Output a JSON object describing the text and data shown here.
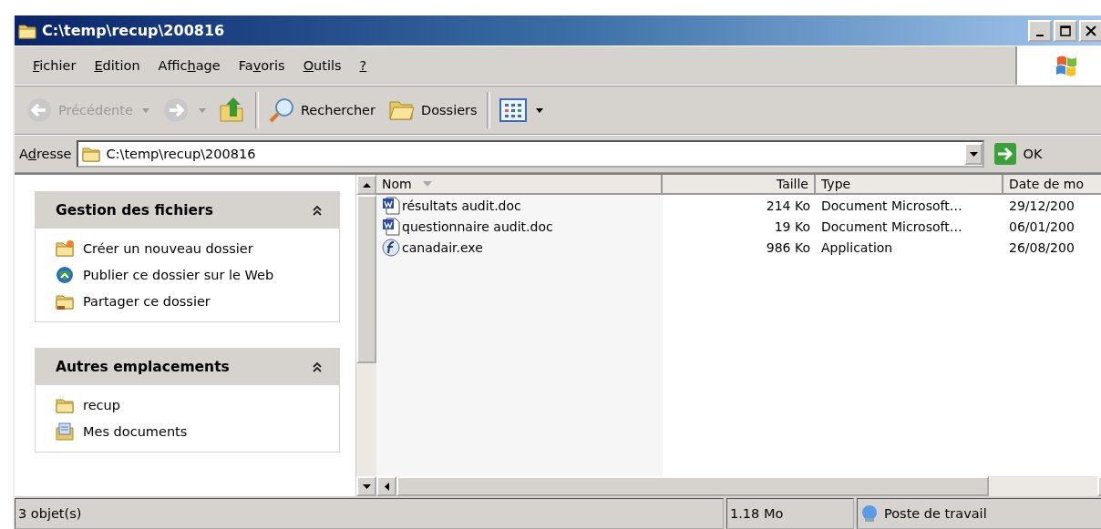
{
  "window": {
    "title": "C:\\temp\\recup\\200816"
  },
  "menu": [
    {
      "key": "F",
      "after": "ichier"
    },
    {
      "key": "E",
      "after": "dition"
    },
    {
      "before": "Affic",
      "key": "h",
      "after": "age"
    },
    {
      "before": "Fa",
      "key": "v",
      "after": "oris"
    },
    {
      "key": "O",
      "after": "utils"
    },
    {
      "key": "?"
    }
  ],
  "toolbar": [
    {
      "kind": "back",
      "label": "Précédente",
      "disabled": true,
      "dropdown": true
    },
    {
      "kind": "forward",
      "disabled": true,
      "dropdown": true
    },
    {
      "kind": "up",
      "disabled": false
    },
    {
      "kind": "sep"
    },
    {
      "kind": "search",
      "label": "Rechercher",
      "disabled": false
    },
    {
      "kind": "folders",
      "label": "Dossiers",
      "disabled": false
    },
    {
      "kind": "sep"
    },
    {
      "kind": "views",
      "disabled": false,
      "dropdown": true
    }
  ],
  "address": {
    "label": {
      "before": "A",
      "key": "d",
      "after": "resse"
    },
    "value": "C:\\temp\\recup\\200816",
    "go": "OK"
  },
  "panels": [
    {
      "title": "Gestion des fichiers",
      "expanded": true,
      "items": [
        {
          "kind": "newfolder",
          "label": "Créer un nouveau dossier"
        },
        {
          "kind": "web",
          "label": "Publier ce dossier sur le Web"
        },
        {
          "kind": "share",
          "label": "Partager ce dossier"
        }
      ]
    },
    {
      "title": "Autres emplacements",
      "expanded": true,
      "items": [
        {
          "kind": "folder",
          "label": "recup"
        },
        {
          "kind": "docs",
          "label": "Mes documents"
        }
      ]
    }
  ],
  "table": {
    "columns": [
      {
        "label": "Nom",
        "sorted": true
      },
      {
        "label": "Taille",
        "sorted": false
      },
      {
        "label": "Type",
        "sorted": false
      },
      {
        "label": "Date de mo",
        "sorted": false
      }
    ],
    "rows": [
      {
        "kind": "doc",
        "cells": [
          "résultats audit.doc",
          "214 Ko",
          "Document Microsoft…",
          "29/12/200"
        ]
      },
      {
        "kind": "doc",
        "cells": [
          "questionnaire audit.doc",
          "19 Ko",
          "Document Microsoft…",
          "06/01/200"
        ]
      },
      {
        "kind": "exe",
        "cells": [
          "canadair.exe",
          "986 Ko",
          "Application",
          "26/08/200"
        ]
      }
    ]
  },
  "status_bar": {
    "count": "3 objet(s)",
    "size": "1.18 Mo",
    "zone": "Poste de travail"
  }
}
